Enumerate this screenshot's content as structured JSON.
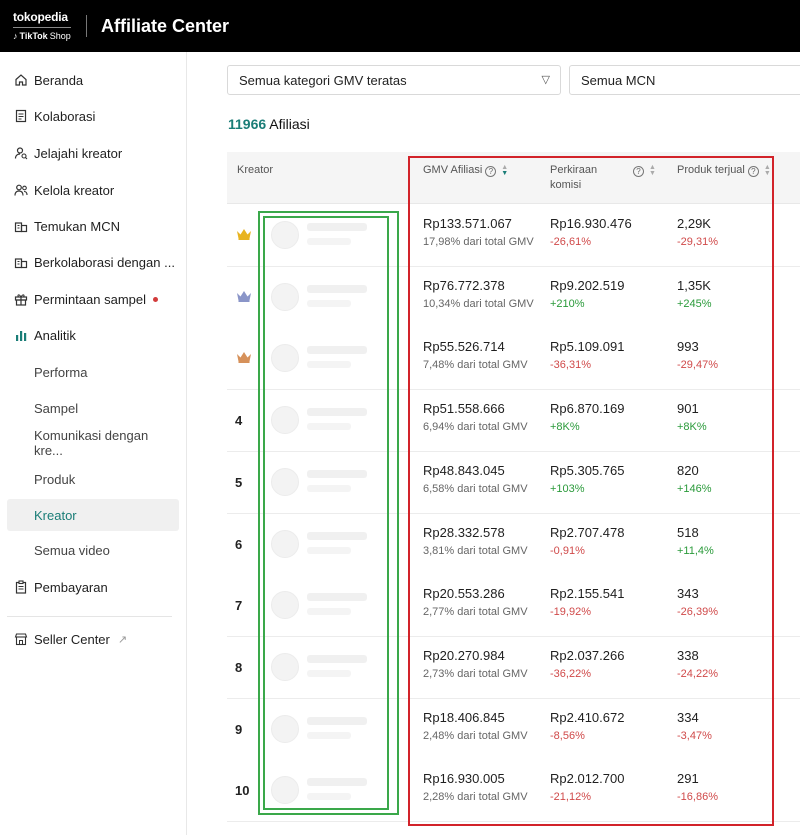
{
  "header": {
    "logo_tokopedia": "tokopedia",
    "logo_tiktok": "TikTok",
    "logo_shop": "Shop",
    "title": "Affiliate Center"
  },
  "sidebar": {
    "items": [
      {
        "label": "Beranda",
        "icon": "home-icon"
      },
      {
        "label": "Kolaborasi",
        "icon": "document-icon"
      },
      {
        "label": "Jelajahi kreator",
        "icon": "person-search-icon"
      },
      {
        "label": "Kelola kreator",
        "icon": "people-icon"
      },
      {
        "label": "Temukan MCN",
        "icon": "building-icon"
      },
      {
        "label": "Berkolaborasi dengan ...",
        "icon": "building-icon"
      },
      {
        "label": "Permintaan sampel",
        "icon": "gift-icon"
      },
      {
        "label": "Analitik",
        "icon": "bar-chart-icon"
      }
    ],
    "analytics_sub": [
      {
        "label": "Performa"
      },
      {
        "label": "Sampel"
      },
      {
        "label": "Komunikasi dengan kre..."
      },
      {
        "label": "Produk"
      },
      {
        "label": "Kreator"
      },
      {
        "label": "Semua video"
      }
    ],
    "payment_label": "Pembayaran",
    "seller_center_label": "Seller Center"
  },
  "filters": {
    "category": "Semua kategori GMV teratas",
    "mcn": "Semua MCN"
  },
  "summary": {
    "count": "11966",
    "label": "Afiliasi"
  },
  "table": {
    "headers": {
      "creator": "Kreator",
      "gmv": "GMV Afiliasi",
      "commission_line1": "Perkiraan",
      "commission_line2": "komisi",
      "sold": "Produk terjual"
    },
    "rows": [
      {
        "rank": "",
        "crown": "gold",
        "gmv": "Rp133.571.067",
        "gmv_share": "17,98% dari total GMV",
        "commission": "Rp16.930.476",
        "commission_change": "-26,61%",
        "sold": "2,29K",
        "sold_change": "-29,31%"
      },
      {
        "rank": "",
        "crown": "silver",
        "gmv": "Rp76.772.378",
        "gmv_share": "10,34% dari total GMV",
        "commission": "Rp9.202.519",
        "commission_change": "+210%",
        "sold": "1,35K",
        "sold_change": "+245%"
      },
      {
        "rank": "",
        "crown": "bronze",
        "gmv": "Rp55.526.714",
        "gmv_share": "7,48% dari total GMV",
        "commission": "Rp5.109.091",
        "commission_change": "-36,31%",
        "sold": "993",
        "sold_change": "-29,47%"
      },
      {
        "rank": "4",
        "crown": "",
        "gmv": "Rp51.558.666",
        "gmv_share": "6,94% dari total GMV",
        "commission": "Rp6.870.169",
        "commission_change": "+8K%",
        "sold": "901",
        "sold_change": "+8K%"
      },
      {
        "rank": "5",
        "crown": "",
        "gmv": "Rp48.843.045",
        "gmv_share": "6,58% dari total GMV",
        "commission": "Rp5.305.765",
        "commission_change": "+103%",
        "sold": "820",
        "sold_change": "+146%"
      },
      {
        "rank": "6",
        "crown": "",
        "gmv": "Rp28.332.578",
        "gmv_share": "3,81% dari total GMV",
        "commission": "Rp2.707.478",
        "commission_change": "-0,91%",
        "sold": "518",
        "sold_change": "+11,4%"
      },
      {
        "rank": "7",
        "crown": "",
        "gmv": "Rp20.553.286",
        "gmv_share": "2,77% dari total GMV",
        "commission": "Rp2.155.541",
        "commission_change": "-19,92%",
        "sold": "343",
        "sold_change": "-26,39%"
      },
      {
        "rank": "8",
        "crown": "",
        "gmv": "Rp20.270.984",
        "gmv_share": "2,73% dari total GMV",
        "commission": "Rp2.037.266",
        "commission_change": "-36,22%",
        "sold": "338",
        "sold_change": "-24,22%"
      },
      {
        "rank": "9",
        "crown": "",
        "gmv": "Rp18.406.845",
        "gmv_share": "2,48% dari total GMV",
        "commission": "Rp2.410.672",
        "commission_change": "-8,56%",
        "sold": "334",
        "sold_change": "-3,47%"
      },
      {
        "rank": "10",
        "crown": "",
        "gmv": "Rp16.930.005",
        "gmv_share": "2,28% dari total GMV",
        "commission": "Rp2.012.700",
        "commission_change": "-21,12%",
        "sold": "291",
        "sold_change": "-16,86%"
      }
    ]
  },
  "colors": {
    "accent": "#1a7d77",
    "positive": "#2a9a3a",
    "negative": "#d04a4a",
    "annotation_red": "#d2232a",
    "annotation_green": "#3aa84a",
    "crown_gold": "#e8b421",
    "crown_silver": "#8a95c8",
    "crown_bronze": "#d6915a"
  }
}
